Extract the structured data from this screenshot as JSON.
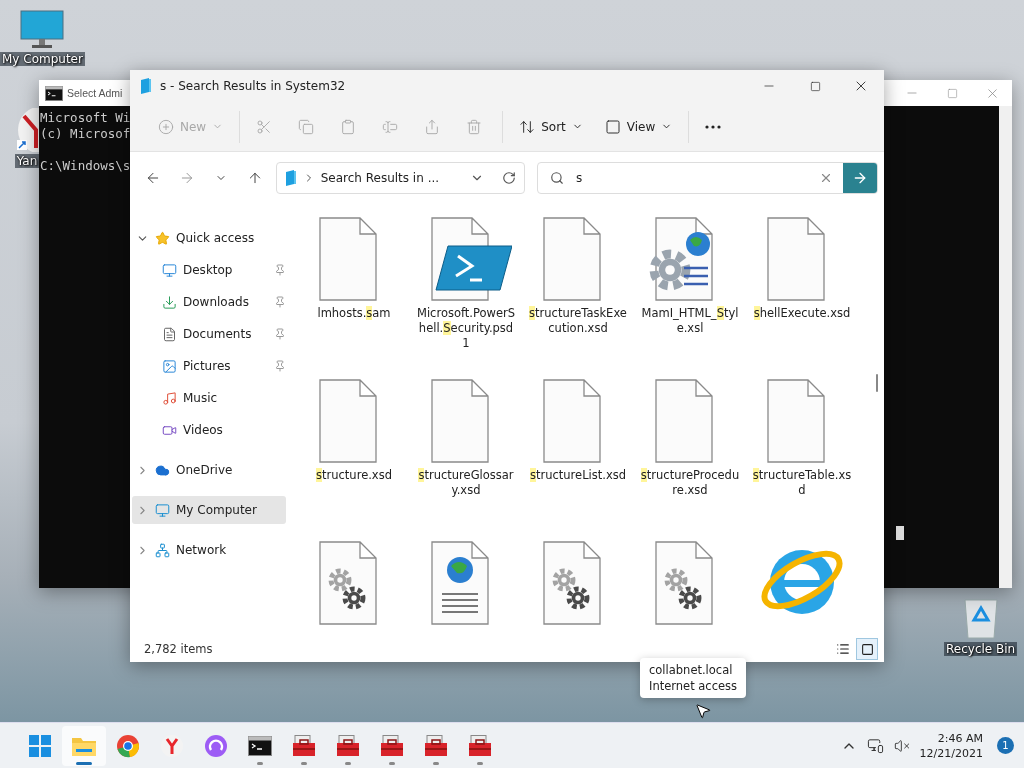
{
  "desktop_icons": [
    {
      "kind": "computer",
      "label": "My Computer"
    },
    {
      "kind": "yandex",
      "label": "Yan"
    },
    {
      "kind": "recycle",
      "label": "Recycle Bin"
    }
  ],
  "console": {
    "title": "Select Admi",
    "lines": [
      "Microsoft Wi",
      "(c) Microsof"
    ],
    "prompt": "C:\\Windows\\s"
  },
  "explorer": {
    "title": "s - Search Results in System32",
    "toolbar_groups": [
      [
        {
          "kind": "new",
          "label": "New",
          "disabled": true
        }
      ],
      [
        {
          "kind": "cut",
          "disabled": true
        },
        {
          "kind": "copy",
          "disabled": true
        },
        {
          "kind": "paste",
          "disabled": true
        },
        {
          "kind": "rename",
          "disabled": true
        },
        {
          "kind": "share",
          "disabled": true
        },
        {
          "kind": "delete",
          "disabled": true
        }
      ],
      [
        {
          "kind": "sort",
          "label": "Sort",
          "disabled": false
        },
        {
          "kind": "view",
          "label": "View",
          "disabled": false
        }
      ],
      [
        {
          "kind": "more",
          "disabled": false
        }
      ]
    ],
    "address": "Search Results in ...",
    "search": {
      "value": "s"
    },
    "nav": [
      {
        "kind": "star",
        "label": "Quick access",
        "expanded": true,
        "selected": false,
        "children": [
          {
            "kind": "desktop",
            "label": "Desktop",
            "pinned": true,
            "selected": false
          },
          {
            "kind": "downloads",
            "label": "Downloads",
            "pinned": true,
            "selected": false
          },
          {
            "kind": "documents",
            "label": "Documents",
            "pinned": true,
            "selected": false
          },
          {
            "kind": "pictures",
            "label": "Pictures",
            "pinned": true,
            "selected": false
          },
          {
            "kind": "music",
            "label": "Music",
            "pinned": false,
            "selected": false
          },
          {
            "kind": "videos",
            "label": "Videos",
            "pinned": false,
            "selected": false
          }
        ]
      },
      {
        "kind": "cloud",
        "label": "OneDrive",
        "expanded": false,
        "selected": false
      },
      {
        "kind": "computer",
        "label": "My Computer",
        "expanded": false,
        "selected": true
      },
      {
        "kind": "network",
        "label": "Network",
        "expanded": false,
        "selected": false
      }
    ],
    "files": [
      {
        "kind": "blank",
        "name": {
          "before": "lmhosts.",
          "match": "s",
          "after": "am"
        }
      },
      {
        "kind": "powershell",
        "name": {
          "before": "Microsoft.PowerShell.",
          "match": "S",
          "after": "ecurity.psd1"
        }
      },
      {
        "kind": "blank",
        "name": {
          "match": "s",
          "after": "tructureTaskExecution.xsd"
        }
      },
      {
        "kind": "xsl",
        "name": {
          "before": "MamI_HTML_",
          "match": "S",
          "after": "tyle.xsl"
        }
      },
      {
        "kind": "blank",
        "name": {
          "match": "s",
          "after": "hellExecute.xsd"
        }
      },
      {
        "kind": "blank",
        "name": {
          "match": "s",
          "after": "tructure.xsd"
        }
      },
      {
        "kind": "blank",
        "name": {
          "match": "s",
          "after": "tructureGlossary.xsd"
        }
      },
      {
        "kind": "blank",
        "name": {
          "match": "s",
          "after": "tructureList.xsd"
        }
      },
      {
        "kind": "blank",
        "name": {
          "match": "s",
          "after": "tructureProcedure.xsd"
        }
      },
      {
        "kind": "blank",
        "name": {
          "match": "s",
          "after": "tructureTable.xsd"
        }
      },
      {
        "kind": "dll"
      },
      {
        "kind": "html"
      },
      {
        "kind": "dll"
      },
      {
        "kind": "dll"
      },
      {
        "kind": "ie"
      }
    ],
    "status": "2,782 items",
    "views": [
      {
        "kind": "details",
        "selected": false
      },
      {
        "kind": "icons",
        "selected": true
      }
    ]
  },
  "tooltip": [
    "collabnet.local",
    "Internet access"
  ],
  "taskbar": {
    "apps": [
      {
        "kind": "start",
        "running": false,
        "active": false
      },
      {
        "kind": "explorer",
        "running": true,
        "active": true
      },
      {
        "kind": "chrome",
        "running": false,
        "active": false
      },
      {
        "kind": "yandex",
        "running": false,
        "active": false
      },
      {
        "kind": "alice",
        "running": false,
        "active": false
      },
      {
        "kind": "console",
        "running": true,
        "active": false
      },
      {
        "kind": "toolbox",
        "running": true,
        "active": false
      },
      {
        "kind": "toolbox",
        "running": true,
        "active": false
      },
      {
        "kind": "toolbox",
        "running": true,
        "active": false
      },
      {
        "kind": "toolbox",
        "running": true,
        "active": false
      },
      {
        "kind": "toolbox",
        "running": true,
        "active": false
      }
    ],
    "time": "2:46 AM",
    "date": "12/21/2021",
    "badge": "1"
  }
}
